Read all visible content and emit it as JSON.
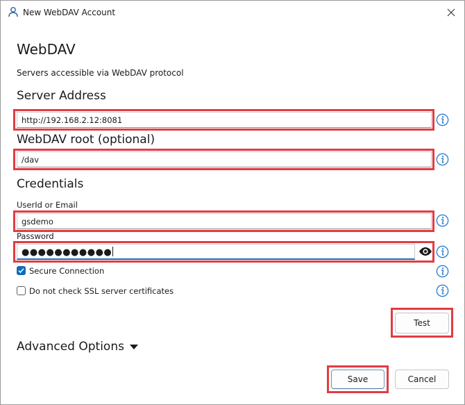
{
  "window": {
    "title": "New WebDAV Account"
  },
  "header": {
    "title": "WebDAV",
    "subtitle": "Servers accessible via WebDAV protocol"
  },
  "server_address": {
    "label": "Server Address",
    "value": "http://192.168.2.12:8081"
  },
  "webdav_root": {
    "label": "WebDAV root (optional)",
    "value": "/dav"
  },
  "credentials": {
    "label": "Credentials",
    "userid_label": "UserId or Email",
    "userid_value": "gsdemo",
    "password_label": "Password",
    "password_masked": "●●●●●●●●●●●"
  },
  "options": {
    "secure_connection": {
      "label": "Secure Connection",
      "checked": true
    },
    "skip_ssl_check": {
      "label": "Do not check SSL server certificates",
      "checked": false
    }
  },
  "buttons": {
    "test": "Test",
    "save": "Save",
    "cancel": "Cancel"
  },
  "advanced": {
    "label": "Advanced Options"
  },
  "colors": {
    "highlight": "#e03c42",
    "accent": "#0f6cbd",
    "info": "#2a7fd4"
  },
  "icons": {
    "title": "user-icon",
    "close": "close-icon",
    "info": "info-icon",
    "eye": "eye-icon",
    "caret": "caret-down-icon",
    "check": "check-icon"
  }
}
